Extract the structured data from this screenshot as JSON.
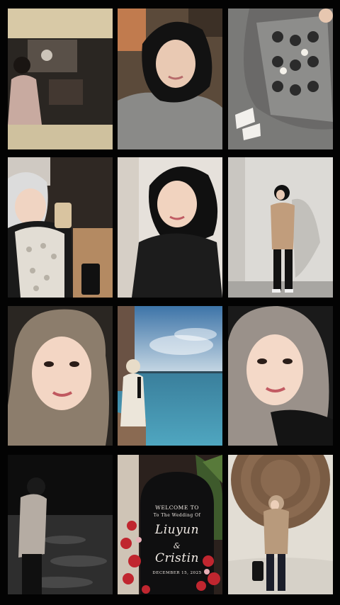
{
  "collage": {
    "sign": {
      "line1": "WELCOME TO",
      "line2": "To The Wedding Of",
      "name1": "Liuyun",
      "ampersand": "&",
      "name2": "Cristin",
      "date": "DECEMBER 15, 2025"
    },
    "photos": [
      "mirror-selfie-dark-room",
      "selfie-black-hijab-grey-top",
      "grey-cutout-jacket-outfit",
      "selfie-with-drink-lace-top",
      "selfie-black-hijab-black-top",
      "full-body-beige-jacket",
      "closeup-taupe-hijab",
      "sea-view-from-boat",
      "closeup-grey-hijab",
      "night-beach-walk",
      "wedding-welcome-sign",
      "rattan-wall-pose"
    ],
    "colors": {
      "background": "#030303",
      "sea": "#3f8fb0",
      "sky": "#7fb0d8"
    }
  }
}
